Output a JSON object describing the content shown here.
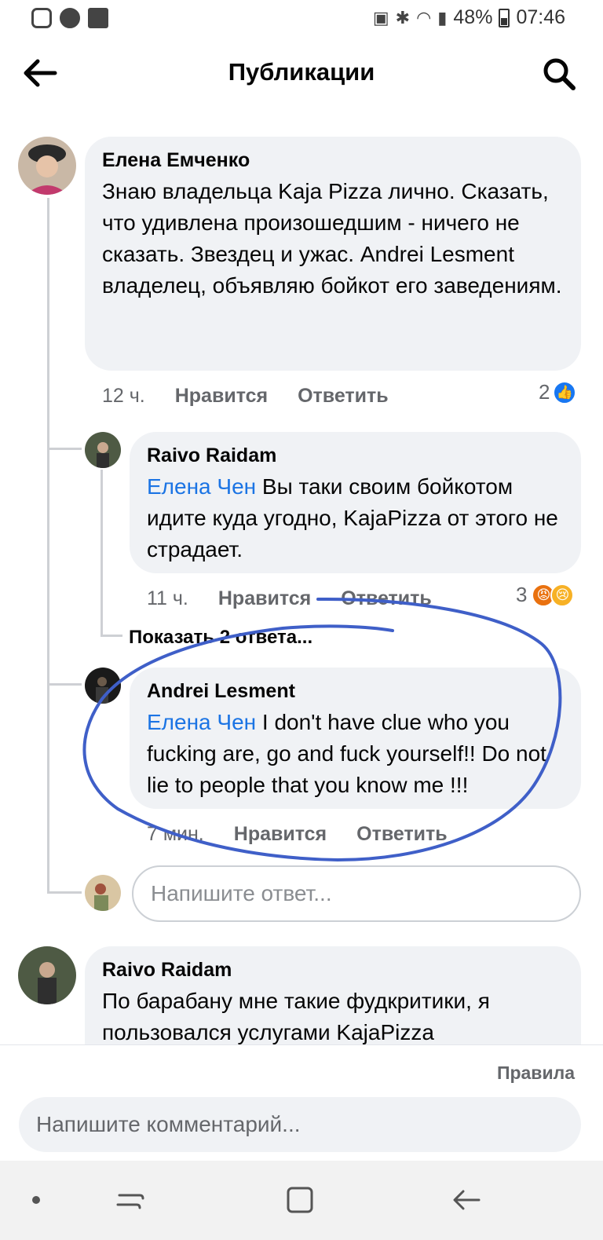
{
  "status_bar": {
    "battery": "48%",
    "time": "07:46",
    "icons": [
      "instagram-icon",
      "shazam-icon",
      "gallery-icon",
      "battery-saver-icon",
      "bluetooth-icon",
      "wifi-icon",
      "signal-icon"
    ]
  },
  "header": {
    "title": "Публикации",
    "back_icon": "arrow-left-icon",
    "search_icon": "search-icon"
  },
  "comments": [
    {
      "author": "Елена Емченко",
      "text": "Знаю владельца Kaja Pizza лично. Сказать, что удивлена произошедшим - ничего не сказать. Звездец и ужас. Andrei Lesment владелец, объявляю бойкот его заведениям.",
      "time": "12 ч.",
      "like_label": "Нравится",
      "reply_label": "Ответить",
      "reaction_count": "2",
      "reactions": [
        "like"
      ]
    },
    {
      "author": "Raivo Raidam",
      "mention": "Елена Чен",
      "text": " Вы таки своим бойкотом идите куда угодно, KajaPizza от этого не страдает.",
      "time": "11 ч.",
      "like_label": "Нравится",
      "reply_label": "Ответить",
      "reaction_count": "3",
      "reactions": [
        "angry",
        "sad"
      ]
    },
    {
      "author": "Andrei Lesment",
      "mention": "Елена Чен",
      "text": " I don't have clue who you fucking are, go and fuck yourself!! Do not lie to people that you know me !!!",
      "time": "7 мин.",
      "like_label": "Нравится",
      "reply_label": "Ответить"
    },
    {
      "author": "Raivo Raidam",
      "text": "По барабану мне такие фудкритики, я пользовался услугами KajaPizza"
    }
  ],
  "show_replies": "Показать 2 ответа...",
  "reply_placeholder": "Напишите ответ...",
  "composer": {
    "rules_label": "Правила",
    "placeholder": "Напишите комментарий..."
  },
  "colors": {
    "mention": "#1b74e4",
    "bubble": "#f0f2f5",
    "highlight_ink": "#3f5fc8",
    "like": "#1877f2"
  }
}
